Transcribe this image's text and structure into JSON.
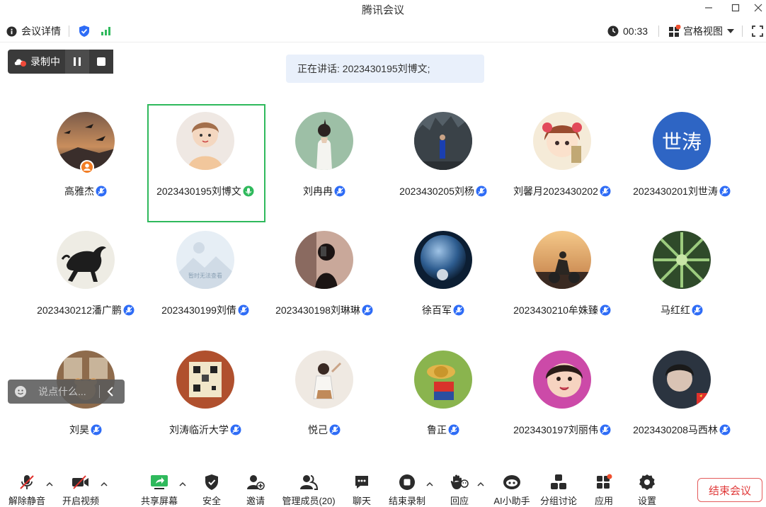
{
  "window": {
    "title": "腾讯会议"
  },
  "topbar": {
    "meeting_details": "会议详情",
    "timer": "00:33",
    "view_mode": "宫格视图"
  },
  "recording": {
    "label": "录制中"
  },
  "speaking": {
    "text": "正在讲话: 2023430195刘博文;"
  },
  "participants": [
    {
      "name": "高雅杰",
      "avatar": "bird-landscape",
      "mic": "muted"
    },
    {
      "name": "2023430195刘博文",
      "avatar": "cartoon-girl",
      "mic": "active"
    },
    {
      "name": "刘冉冉",
      "avatar": "girl-back",
      "mic": "muted"
    },
    {
      "name": "2023430205刘杨",
      "avatar": "rocks-photo",
      "mic": "muted"
    },
    {
      "name": "刘馨月2023430202",
      "avatar": "anime-girl",
      "mic": "muted"
    },
    {
      "name": "2023430201刘世涛",
      "avatar": "text",
      "avatar_text": "世涛",
      "mic": "muted"
    },
    {
      "name": "2023430212潘广鹏",
      "avatar": "horse-ink",
      "mic": "muted"
    },
    {
      "name": "2023430199刘倩",
      "avatar": "placeholder",
      "avatar_text": "暂时无法查看",
      "mic": "muted"
    },
    {
      "name": "2023430198刘琳琳",
      "avatar": "mirror-selfie",
      "mic": "muted"
    },
    {
      "name": "徐百军",
      "avatar": "planet",
      "mic": "muted"
    },
    {
      "name": "2023430210牟姝臻",
      "avatar": "motorbike-sunset",
      "mic": "muted"
    },
    {
      "name": "马红红",
      "avatar": "leaf-green",
      "mic": "muted"
    },
    {
      "name": "刘昊",
      "avatar": "bear-cartoon",
      "mic": "muted"
    },
    {
      "name": "刘涛临沂大学",
      "avatar": "qr-code",
      "mic": "muted"
    },
    {
      "name": "悦己",
      "avatar": "girl-illustration",
      "mic": "muted"
    },
    {
      "name": "鲁正",
      "avatar": "luffy-grass",
      "mic": "muted"
    },
    {
      "name": "2023430197刘丽伟",
      "avatar": "child-photo",
      "mic": "muted"
    },
    {
      "name": "2023430208马西林",
      "avatar": "boy-photo",
      "mic": "muted"
    }
  ],
  "chat": {
    "placeholder": "说点什么..."
  },
  "toolbar": {
    "unmute": "解除静音",
    "video": "开启视频",
    "share": "共享屏幕",
    "security": "安全",
    "invite": "邀请",
    "members": "管理成员(20)",
    "chat": "聊天",
    "end_record": "结束录制",
    "react": "回应",
    "ai": "AI小助手",
    "breakout": "分组讨论",
    "apps": "应用",
    "settings": "设置",
    "end_meeting": "结束会议"
  },
  "colors": {
    "accent": "#2e6cf6",
    "speaking_green": "#2fb95c",
    "end_red": "#e03a3a"
  }
}
